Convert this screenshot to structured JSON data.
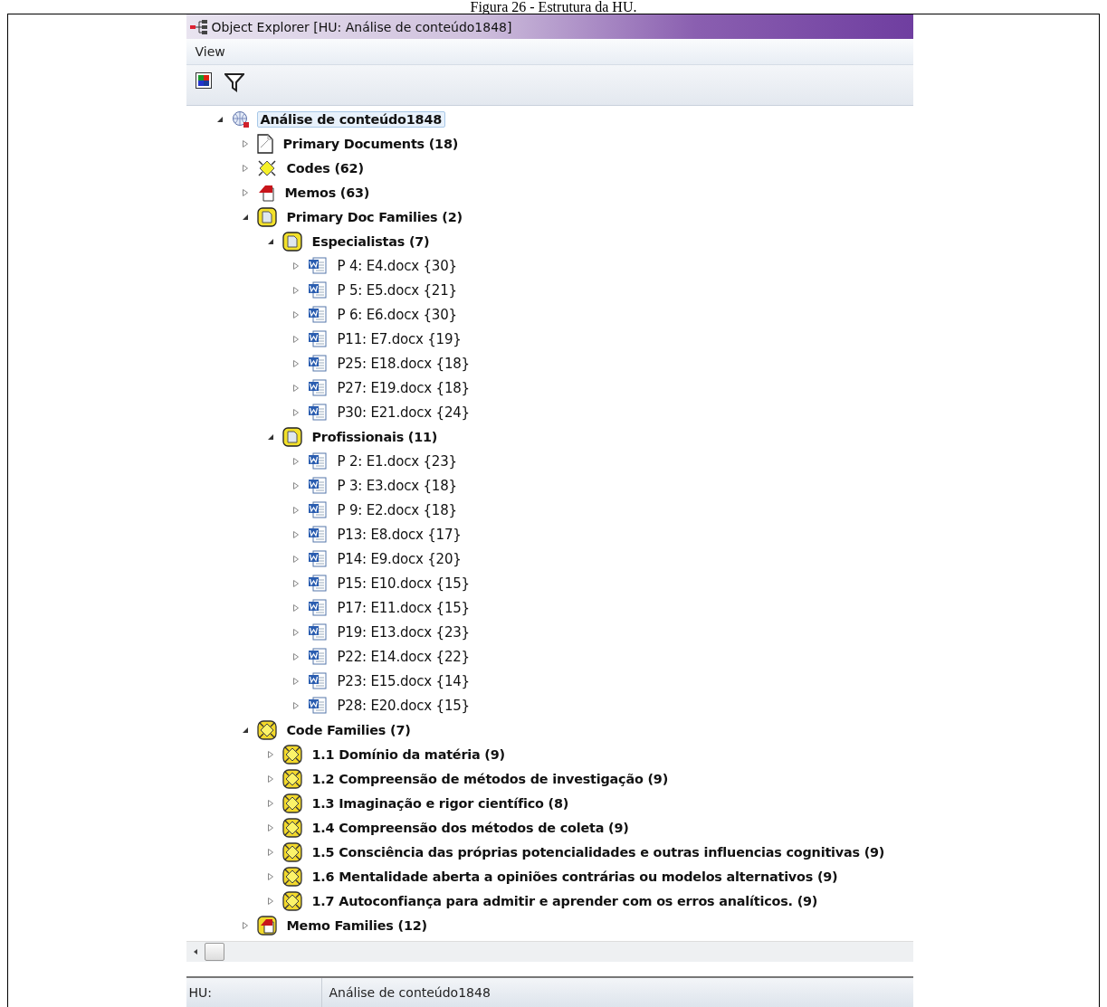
{
  "caption": "Figura 26 - Estrutura da HU.",
  "window": {
    "title": "Object Explorer  [HU: Análise de conteúdo1848]"
  },
  "menu": [
    "View"
  ],
  "tree": [
    {
      "kind": "root",
      "label": "Análise de conteúdo1848",
      "expanded": true,
      "selected": true,
      "children": [
        {
          "kind": "documents",
          "label": "Primary Documents (18)",
          "expanded": false,
          "selected": false
        },
        {
          "kind": "codes",
          "label": "Codes (62)",
          "expanded": false,
          "selected": false
        },
        {
          "kind": "memos",
          "label": "Memos (63)",
          "expanded": false,
          "selected": false
        },
        {
          "kind": "docfamily",
          "label": "Primary Doc Families (2)",
          "expanded": true,
          "selected": false,
          "children": [
            {
              "kind": "docfamily",
              "label": "Especialistas (7)",
              "expanded": true,
              "selected": false,
              "children": [
                {
                  "kind": "file",
                  "label": "P 4: E4.docx {30}",
                  "expanded": false,
                  "selected": false
                },
                {
                  "kind": "file",
                  "label": "P 5: E5.docx {21}",
                  "expanded": false,
                  "selected": false
                },
                {
                  "kind": "file",
                  "label": "P 6: E6.docx {30}",
                  "expanded": false,
                  "selected": false
                },
                {
                  "kind": "file",
                  "label": "P11: E7.docx {19}",
                  "expanded": false,
                  "selected": false
                },
                {
                  "kind": "file",
                  "label": "P25: E18.docx {18}",
                  "expanded": false,
                  "selected": false
                },
                {
                  "kind": "file",
                  "label": "P27: E19.docx {18}",
                  "expanded": false,
                  "selected": false
                },
                {
                  "kind": "file",
                  "label": "P30: E21.docx {24}",
                  "expanded": false,
                  "selected": false
                }
              ]
            },
            {
              "kind": "docfamily",
              "label": "Profissionais (11)",
              "expanded": true,
              "selected": false,
              "children": [
                {
                  "kind": "file",
                  "label": "P 2: E1.docx {23}",
                  "expanded": false,
                  "selected": false
                },
                {
                  "kind": "file",
                  "label": "P 3: E3.docx {18}",
                  "expanded": false,
                  "selected": false
                },
                {
                  "kind": "file",
                  "label": "P 9: E2.docx {18}",
                  "expanded": false,
                  "selected": false
                },
                {
                  "kind": "file",
                  "label": "P13: E8.docx {17}",
                  "expanded": false,
                  "selected": false
                },
                {
                  "kind": "file",
                  "label": "P14: E9.docx {20}",
                  "expanded": false,
                  "selected": false
                },
                {
                  "kind": "file",
                  "label": "P15: E10.docx {15}",
                  "expanded": false,
                  "selected": false
                },
                {
                  "kind": "file",
                  "label": "P17: E11.docx {15}",
                  "expanded": false,
                  "selected": false
                },
                {
                  "kind": "file",
                  "label": "P19: E13.docx {23}",
                  "expanded": false,
                  "selected": false
                },
                {
                  "kind": "file",
                  "label": "P22: E14.docx {22}",
                  "expanded": false,
                  "selected": false
                },
                {
                  "kind": "file",
                  "label": "P23: E15.docx {14}",
                  "expanded": false,
                  "selected": false
                },
                {
                  "kind": "file",
                  "label": "P28: E20.docx {15}",
                  "expanded": false,
                  "selected": false
                }
              ]
            }
          ]
        },
        {
          "kind": "codefamily",
          "label": "Code Families (7)",
          "expanded": true,
          "selected": false,
          "children": [
            {
              "kind": "codefamily",
              "label": "1.1 Domínio da matéria (9)",
              "expanded": false,
              "selected": false
            },
            {
              "kind": "codefamily",
              "label": "1.2 Compreensão de métodos de investigação (9)",
              "expanded": false,
              "selected": false
            },
            {
              "kind": "codefamily",
              "label": "1.3 Imaginação e rigor científico (8)",
              "expanded": false,
              "selected": false
            },
            {
              "kind": "codefamily",
              "label": "1.4 Compreensão dos métodos de coleta (9)",
              "expanded": false,
              "selected": false
            },
            {
              "kind": "codefamily",
              "label": "1.5 Consciência das próprias potencialidades e outras influencias cognitivas (9)",
              "expanded": false,
              "selected": false
            },
            {
              "kind": "codefamily",
              "label": "1.6 Mentalidade aberta a opiniões contrárias ou modelos alternativos (9)",
              "expanded": false,
              "selected": false
            },
            {
              "kind": "codefamily",
              "label": "1.7 Autoconfiança para admitir e aprender com os erros analíticos. (9)",
              "expanded": false,
              "selected": false
            }
          ]
        },
        {
          "kind": "memofamily",
          "label": "Memo Families (12)",
          "expanded": false,
          "selected": false
        }
      ]
    }
  ],
  "status_bar": {
    "label": "HU:",
    "value": "Análise de conteúdo1848"
  }
}
